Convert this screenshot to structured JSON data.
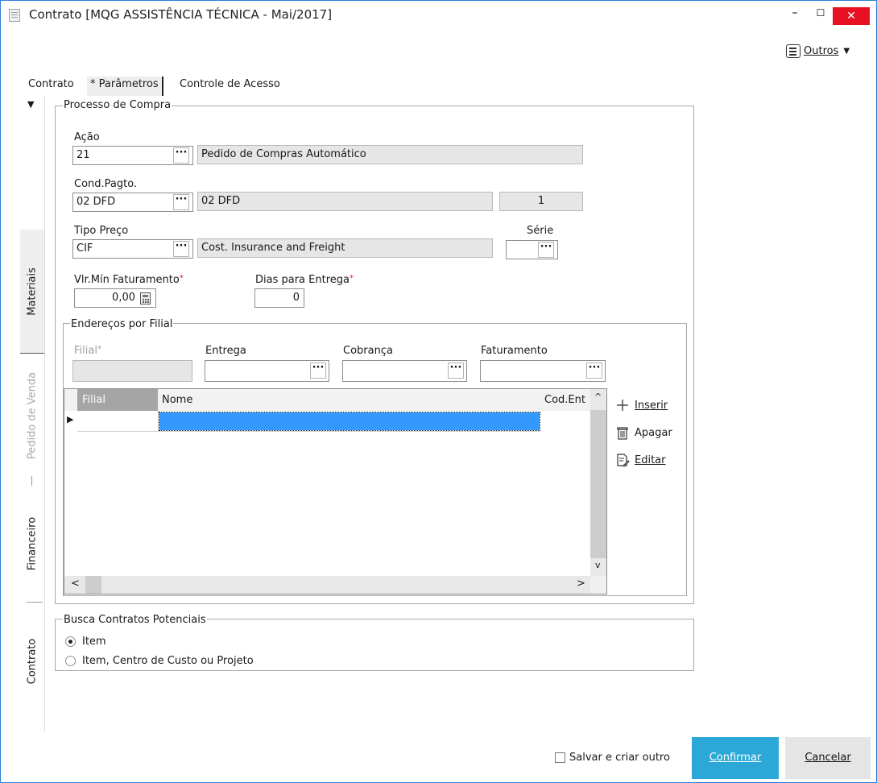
{
  "window": {
    "title": "Contrato [MQG ASSISTÊNCIA TÉCNICA - Mai/2017]",
    "minimize": "–",
    "maximize": "☐",
    "close": "✕"
  },
  "toolbar": {
    "outros_label": "Outros",
    "outros_arrow": "▼"
  },
  "tabs": [
    {
      "label": "Contrato"
    },
    {
      "label": "* Parâmetros",
      "active": true
    },
    {
      "label": "Controle de Acesso"
    }
  ],
  "side_tabs": {
    "collapse_arrow": "▼",
    "items": [
      {
        "label": "Materiais",
        "active": true
      },
      {
        "label": "Pedido de Venda",
        "disabled": true
      },
      {
        "label": "Financeiro"
      },
      {
        "label": "Contrato"
      }
    ]
  },
  "processo_compra": {
    "title": "Processo de Compra",
    "acao": {
      "label": "Ação",
      "code": "21",
      "description": "Pedido de Compras Automático"
    },
    "cond_pagto": {
      "label": "Cond.Pagto.",
      "code": "02 DFD",
      "description": "02 DFD",
      "extra": "1"
    },
    "tipo_preco": {
      "label": "Tipo Preço",
      "code": "CIF",
      "description": "Cost. Insurance and Freight"
    },
    "serie": {
      "label": "Série",
      "value": ""
    },
    "vlr_min": {
      "label": "Vlr.Mín Faturamento",
      "required_mark": "*",
      "value": "0,00"
    },
    "dias_entrega": {
      "label": "Dias para Entrega",
      "required_mark": "*",
      "value": "0"
    },
    "dots": "···"
  },
  "enderecos": {
    "title": "Endereços por Filial",
    "filial_label": "Filial",
    "filial_required": "*",
    "entrega_label": "Entrega",
    "cobranca_label": "Cobrança",
    "faturamento_label": "Faturamento",
    "grid": {
      "columns": [
        "Filial",
        "Nome",
        "Cod.Ent"
      ],
      "row_indicator": "▶",
      "scroll_up": "^",
      "scroll_down": "v",
      "scroll_left": "<",
      "scroll_right": ">"
    },
    "actions": {
      "inserir": "Inserir",
      "apagar": "Apagar",
      "editar": "Editar"
    }
  },
  "busca": {
    "title": "Busca Contratos Potenciais",
    "options": [
      {
        "label": "Item",
        "selected": true
      },
      {
        "label": "Item, Centro de Custo ou Projeto",
        "selected": false
      }
    ]
  },
  "footer": {
    "salvar_criar_outro": "Salvar e criar outro",
    "confirmar": "Confirmar",
    "cancelar": "Cancelar"
  },
  "colors": {
    "accent": "#2ba8d8",
    "selection": "#3399ff",
    "close": "#e81123",
    "required": "#e81123"
  }
}
